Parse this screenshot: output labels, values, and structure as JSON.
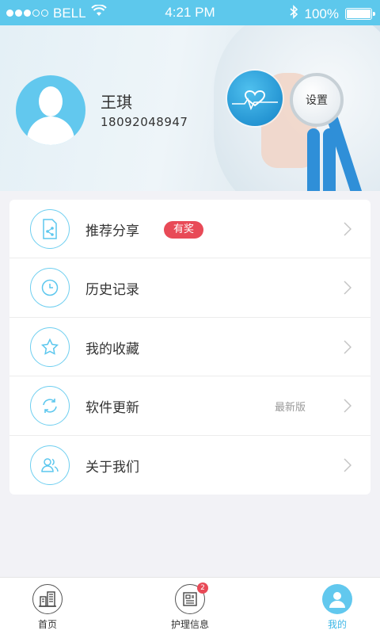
{
  "status_bar": {
    "carrier": "BELL",
    "time": "4:21 PM",
    "battery": "100%",
    "battery_level": 1.0
  },
  "profile": {
    "name": "王琪",
    "phone": "18092048947",
    "settings_label": "设置"
  },
  "menu": {
    "items": [
      {
        "label": "推荐分享",
        "icon": "share-document-icon",
        "badge": "有奖"
      },
      {
        "label": "历史记录",
        "icon": "clock-icon"
      },
      {
        "label": "我的收藏",
        "icon": "star-icon"
      },
      {
        "label": "软件更新",
        "icon": "refresh-icon",
        "value": "最新版"
      },
      {
        "label": "关于我们",
        "icon": "users-icon"
      }
    ]
  },
  "tab_bar": {
    "tabs": [
      {
        "label": "首页",
        "icon": "building-icon"
      },
      {
        "label": "护理信息",
        "icon": "news-icon",
        "badge": "2"
      },
      {
        "label": "我的",
        "icon": "user-icon",
        "active": true
      }
    ]
  },
  "colors": {
    "accent": "#62c8ee",
    "status_bar": "#5dc8ec",
    "badge": "#e84a57",
    "active_tab_text": "#3eb7e6"
  }
}
